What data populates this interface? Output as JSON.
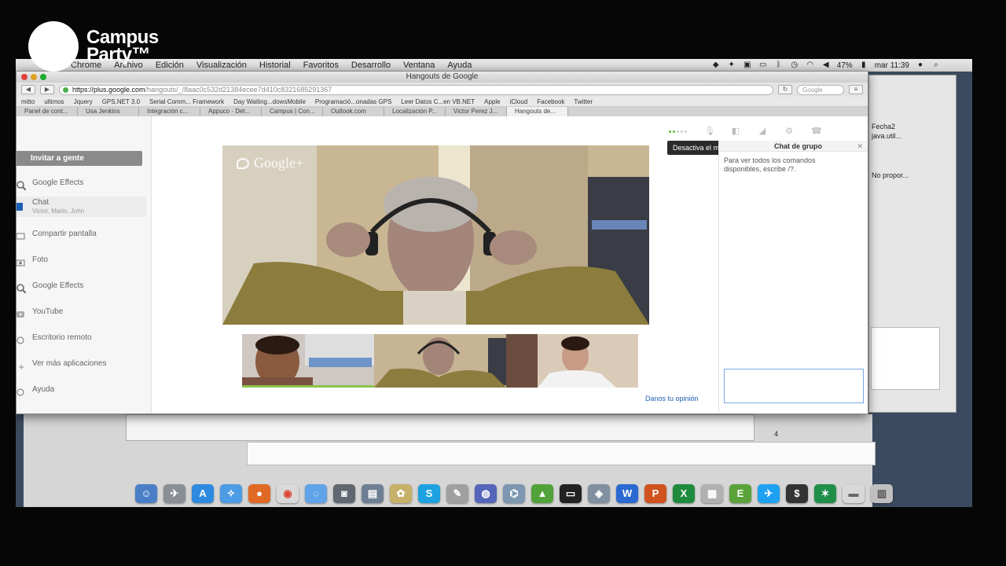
{
  "overlay": {
    "logo_line1": "Campus",
    "logo_line2": "Party™"
  },
  "menubar": {
    "items": [
      "Chrome",
      "Archivo",
      "Edición",
      "Visualización",
      "Historial",
      "Favoritos",
      "Desarrollo",
      "Ventana",
      "Ayuda"
    ],
    "battery": "47%",
    "clock": "mar 11:39"
  },
  "browser": {
    "window_title": "Hangouts de Google",
    "url_domain": "https://plus.google.com",
    "url_path": "/hangouts/_/8aac0c532d21384ecee7d410c8321685291367",
    "search_placeholder": "Google",
    "bookmarks": [
      "mitto",
      "ultimos",
      "Jquery",
      "GPS.NET 3.0",
      "Serial Comm... Framework",
      "Day Waiting...dowsMobile",
      "Programació...onadas GPS",
      "Leer Datos C...en VB.NET",
      "Apple",
      "iCloud",
      "Facebook",
      "Twitter"
    ],
    "tabs": [
      "Panel de cont...",
      "Usa Jenkins",
      "Integración c...",
      "Appuco · Det...",
      "Campus | Con...",
      "Outlook.com",
      "Localización P...",
      "Victor Perez J...",
      "Hangouts de..."
    ]
  },
  "hangout": {
    "invite_label": "Invitar a gente",
    "sidebar": [
      {
        "label": "Google Effects",
        "icon": "effects-icon"
      },
      {
        "label": "Chat",
        "sub": "Victor, Mario, John",
        "icon": "chat-icon"
      },
      {
        "label": "Compartir pantalla",
        "icon": "screenshare-icon"
      },
      {
        "label": "Foto",
        "icon": "camera-icon"
      },
      {
        "label": "Google Effects",
        "icon": "effects-icon"
      },
      {
        "label": "YouTube",
        "icon": "youtube-icon"
      },
      {
        "label": "Escritorio remoto",
        "icon": "remote-desktop-icon"
      },
      {
        "label": "Ver más aplicaciones",
        "icon": "more-apps-icon"
      },
      {
        "label": "Ayuda",
        "icon": "help-icon"
      }
    ],
    "video_watermark": "Google+",
    "tooltip": "Desactiva el micrófono",
    "chat_header": "Chat de grupo",
    "chat_hint": "Para ver todos los comandos disponibles, escribe /?.",
    "feedback": "Danos tu opinión",
    "colors": {
      "accent_green": "#5bbf3b",
      "link_blue": "#1a5fb4"
    }
  },
  "background_window": {
    "field1": "Fecha2",
    "field2": "java.util...",
    "field3": "No propor...",
    "page_number": "4"
  },
  "dock": [
    "finder-icon",
    "launchpad-icon",
    "app-store-icon",
    "safari-icon",
    "firefox-icon",
    "chrome-icon",
    "messages-icon",
    "facetime-icon",
    "preview-icon",
    "photos-icon",
    "skype-icon",
    "app-icon",
    "mail-icon",
    "postgres-icon",
    "android-icon",
    "terminal-icon",
    "app-icon",
    "word-icon",
    "powerpoint-icon",
    "excel-icon",
    "app-icon",
    "evernote-icon",
    "twitter-icon",
    "app-icon",
    "app-icon",
    "folder-icon",
    "trash-icon"
  ]
}
